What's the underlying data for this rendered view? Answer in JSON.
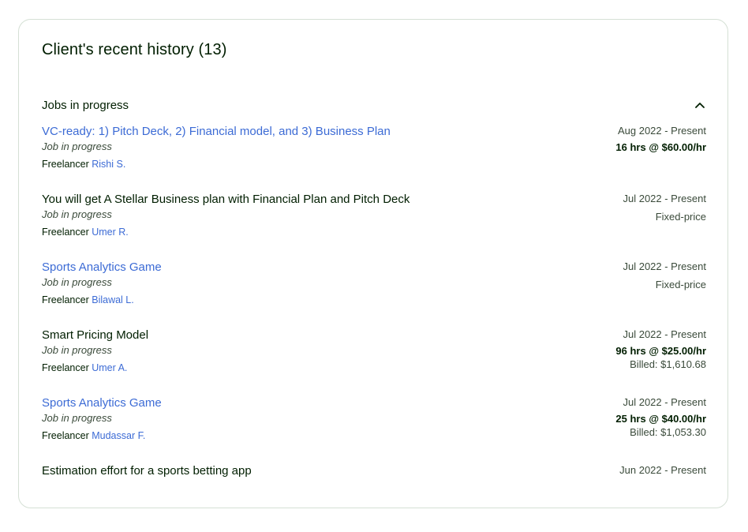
{
  "card": {
    "title": "Client's recent history (13)"
  },
  "section": {
    "title": "Jobs in progress",
    "icon": "chevron-up-icon"
  },
  "jobs": [
    {
      "title": "VC-ready: 1) Pitch Deck, 2) Financial model, and 3) Business Plan",
      "is_link": true,
      "status": "Job in progress",
      "freelancer_prefix": "Freelancer",
      "freelancer": "Rishi S.",
      "date": "Aug 2022 - Present",
      "rate": "16 hrs @ $60.00/hr",
      "rate_type": "hourly",
      "billed": ""
    },
    {
      "title": "You will get A Stellar Business plan with Financial Plan and Pitch Deck",
      "is_link": false,
      "status": "Job in progress",
      "freelancer_prefix": "Freelancer",
      "freelancer": "Umer R.",
      "date": "Jul 2022 - Present",
      "rate": "Fixed-price",
      "rate_type": "fixed",
      "billed": ""
    },
    {
      "title": "Sports Analytics Game",
      "is_link": true,
      "status": "Job in progress",
      "freelancer_prefix": "Freelancer",
      "freelancer": "Bilawal L.",
      "date": "Jul 2022 - Present",
      "rate": "Fixed-price",
      "rate_type": "fixed",
      "billed": ""
    },
    {
      "title": "Smart Pricing Model",
      "is_link": false,
      "status": "Job in progress",
      "freelancer_prefix": "Freelancer",
      "freelancer": "Umer A.",
      "date": "Jul 2022 - Present",
      "rate": "96 hrs @ $25.00/hr",
      "rate_type": "hourly",
      "billed": "Billed: $1,610.68"
    },
    {
      "title": "Sports Analytics Game",
      "is_link": true,
      "status": "Job in progress",
      "freelancer_prefix": "Freelancer",
      "freelancer": "Mudassar F.",
      "date": "Jul 2022 - Present",
      "rate": "25 hrs @ $40.00/hr",
      "rate_type": "hourly",
      "billed": "Billed: $1,053.30"
    },
    {
      "title": "Estimation effort for a sports betting app",
      "is_link": false,
      "status": "",
      "freelancer_prefix": "",
      "freelancer": "",
      "date": "Jun 2022 - Present",
      "rate": "",
      "rate_type": "",
      "billed": ""
    }
  ]
}
